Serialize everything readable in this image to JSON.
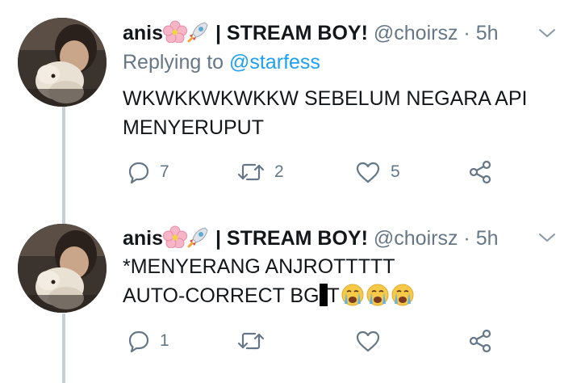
{
  "thread": {
    "tweets": [
      {
        "author": {
          "name_prefix": "anis",
          "name_suffix": "| STREAM BOY!",
          "handle": "@choirsz",
          "separator": "·",
          "time": "5h",
          "avatar_icon": "avatar-photo"
        },
        "replying_to_label": "Replying to ",
        "replying_to_handle": "@starfess",
        "text_lines": [
          "WKWKKWKWKKW SEBELUM NEGARA API",
          "MENYERUPUT"
        ],
        "actions": {
          "reply_count": "7",
          "retweet_count": "2",
          "like_count": "5",
          "icons": [
            "reply-icon",
            "retweet-icon",
            "like-icon",
            "share-icon"
          ]
        }
      },
      {
        "author": {
          "name_prefix": "anis",
          "name_suffix": "| STREAM BOY!",
          "handle": "@choirsz",
          "separator": "·",
          "time": "5h",
          "avatar_icon": "avatar-photo"
        },
        "text_line_1": "*MENYERANG ANJROTTTTT",
        "text_line_2_prefix": "AUTO-CORRECT BG",
        "text_line_2_after_redact": "T",
        "text_emojis": [
          "crying-face-emoji",
          "crying-face-emoji",
          "crying-face-emoji"
        ],
        "actions": {
          "reply_count": "1",
          "icons": [
            "reply-icon",
            "retweet-icon",
            "like-icon",
            "share-icon"
          ]
        }
      }
    ],
    "colors": {
      "text": "#14171a",
      "secondary": "#657786",
      "link": "#1da1f2",
      "thread_line": "#c4cfd6"
    }
  }
}
